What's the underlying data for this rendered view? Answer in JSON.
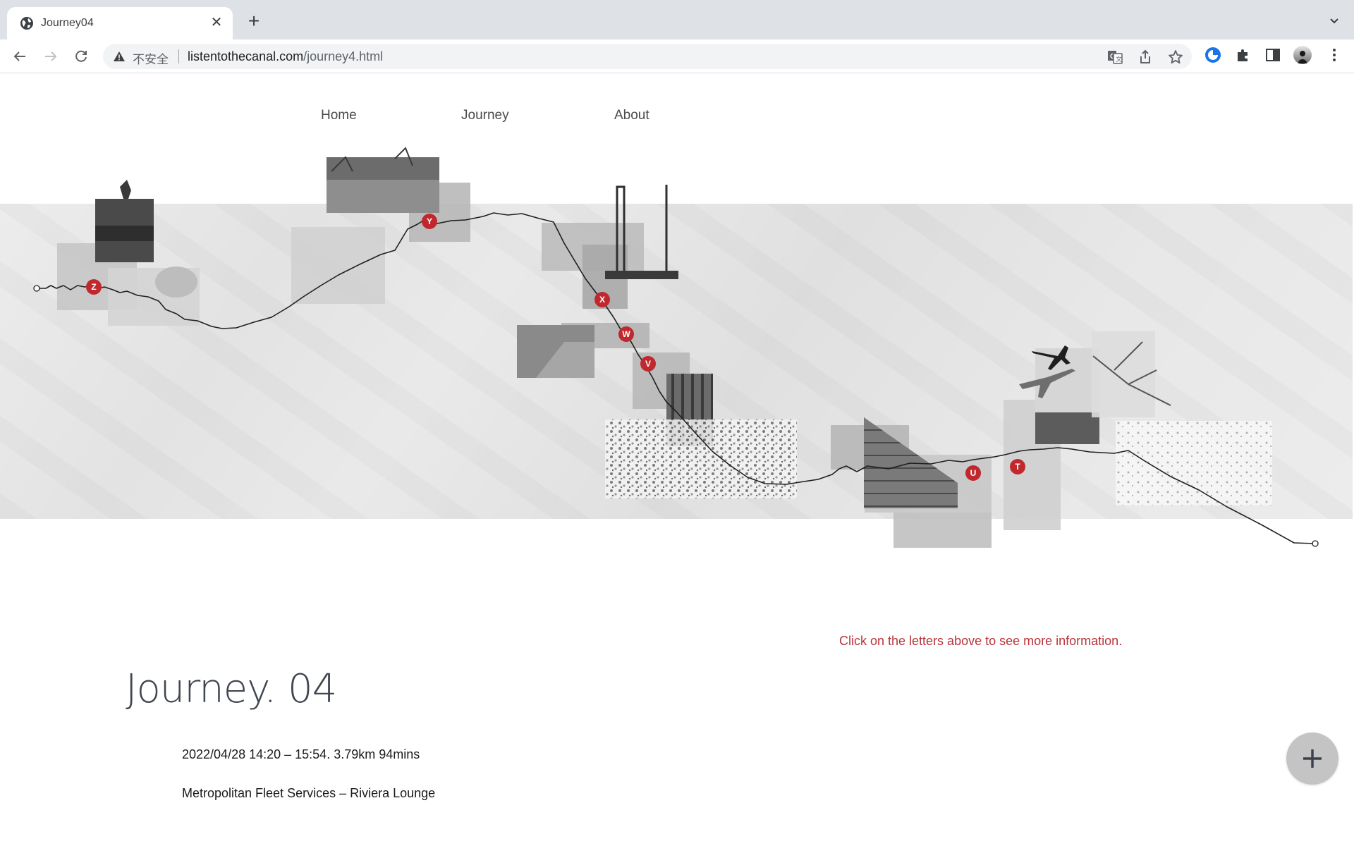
{
  "browser": {
    "tab_title": "Journey04",
    "insecure_label": "不安全",
    "url_domain": "listentothecanal.com",
    "url_path": "/journey4.html",
    "icons": {
      "favicon": "globe-icon",
      "tab_close": "close-icon",
      "new_tab": "plus-icon",
      "tab_search": "chevron-down-icon",
      "back": "arrow-left-icon",
      "forward": "arrow-right-icon",
      "reload": "reload-icon",
      "security": "warning-triangle-icon",
      "translate": "translate-icon",
      "share": "share-icon",
      "bookmark": "star-icon",
      "extension_1": "blue-circle-extension-icon",
      "extensions": "puzzle-icon",
      "side_panel": "side-panel-icon",
      "profile": "avatar-icon",
      "menu": "kebab-menu-icon"
    },
    "tab_close_glyph": "✕",
    "new_tab_glyph": "+"
  },
  "nav": {
    "items": [
      {
        "label": "Home"
      },
      {
        "label": "Journey"
      },
      {
        "label": "About"
      }
    ]
  },
  "map": {
    "markers": [
      "Z",
      "Y",
      "X",
      "W",
      "V",
      "U",
      "T"
    ],
    "marker_color": "#c0282d",
    "photos": [
      "boat-with-tree",
      "aerial-blurred-block",
      "willow-tree-fence",
      "barges-reflection",
      "crane-excavator",
      "aerial-gray-block",
      "construction-cranes",
      "pile-driver-rig",
      "aerial-canal-x",
      "motorway-traffic",
      "aerial-canal-w",
      "aerial-canal-v",
      "metal-fence-gate",
      "overgrown-trees",
      "industrial-building",
      "aerial-u-block",
      "aerial-bottom-block",
      "airplanes-grass",
      "tree-branches",
      "aerial-t-block",
      "snowy-bushes"
    ]
  },
  "hint": "Click on the letters above to see more information.",
  "journey": {
    "title": "Journey. 04",
    "datetime_distance": "2022/04/28 14:20 – 15:54. 3.79km 94mins",
    "route": "Metropolitan Fleet Services – Riviera Lounge"
  },
  "fab": {
    "icon": "plus-icon"
  },
  "colors": {
    "accent_red": "#c0282d",
    "hint_text": "#b8343a",
    "title_text": "#3f4650",
    "fab_bg": "#c4c4c4"
  }
}
